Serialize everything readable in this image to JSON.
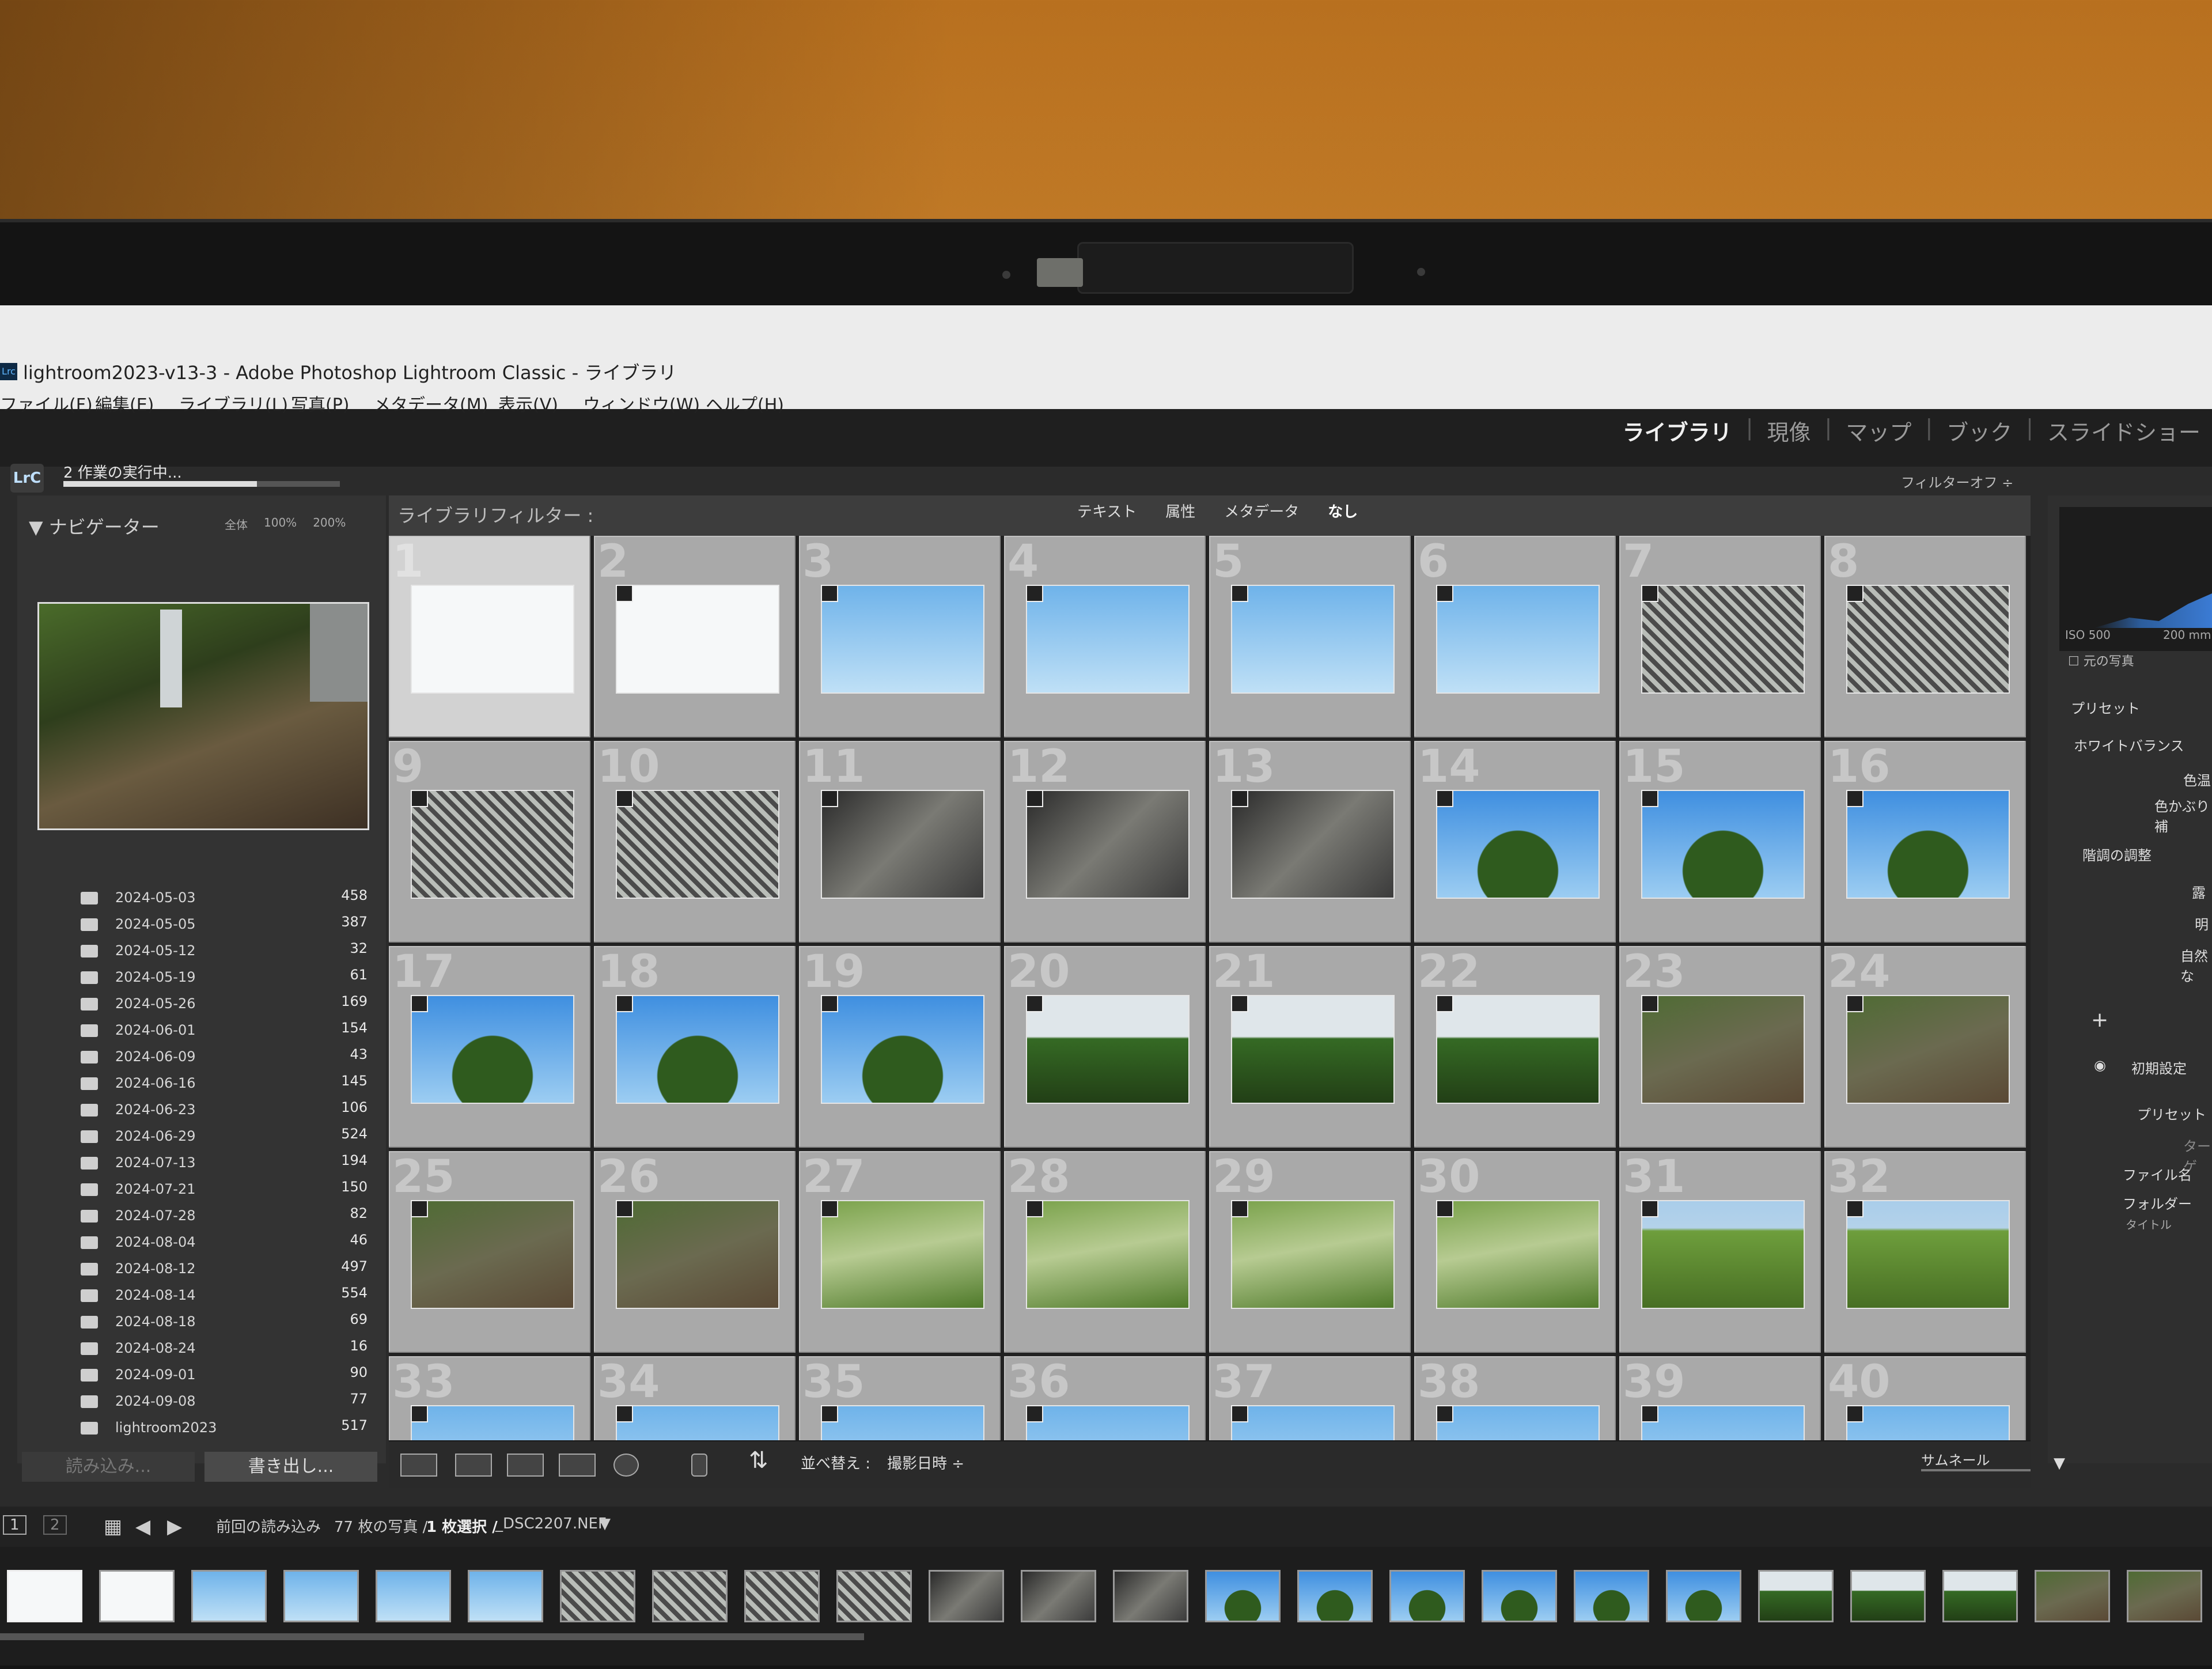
{
  "window": {
    "title": "lightroom2023-v13-3 - Adobe Photoshop Lightroom Classic - ライブラリ",
    "app_icon": "Lrc"
  },
  "menu": [
    "ファイル(F)",
    "編集(E)",
    "ライブラリ(L)",
    "写真(P)",
    "メタデータ(M)",
    "表示(V)",
    "ウィンドウ(W)",
    "ヘルプ(H)"
  ],
  "modules": {
    "items": [
      "ライブラリ",
      "現像",
      "マップ",
      "ブック",
      "スライドショー"
    ],
    "active": "ライブラリ",
    "separator": "|"
  },
  "identity": {
    "badge": "LrC",
    "task_text": "2 作業の実行中...",
    "task_progress": 0.7
  },
  "navigator": {
    "title": "ナビゲーター",
    "zoom_options": [
      "全体",
      "100%",
      "200%"
    ]
  },
  "folders": [
    {
      "name": "2024-05-03",
      "count": "458"
    },
    {
      "name": "2024-05-05",
      "count": "387"
    },
    {
      "name": "2024-05-12",
      "count": "32"
    },
    {
      "name": "2024-05-19",
      "count": "61"
    },
    {
      "name": "2024-05-26",
      "count": "169"
    },
    {
      "name": "2024-06-01",
      "count": "154"
    },
    {
      "name": "2024-06-09",
      "count": "43"
    },
    {
      "name": "2024-06-16",
      "count": "145"
    },
    {
      "name": "2024-06-23",
      "count": "106"
    },
    {
      "name": "2024-06-29",
      "count": "524"
    },
    {
      "name": "2024-07-13",
      "count": "194"
    },
    {
      "name": "2024-07-21",
      "count": "150"
    },
    {
      "name": "2024-07-28",
      "count": "82"
    },
    {
      "name": "2024-08-04",
      "count": "46"
    },
    {
      "name": "2024-08-12",
      "count": "497"
    },
    {
      "name": "2024-08-14",
      "count": "554"
    },
    {
      "name": "2024-08-18",
      "count": "69"
    },
    {
      "name": "2024-08-24",
      "count": "16"
    },
    {
      "name": "2024-09-01",
      "count": "90"
    },
    {
      "name": "2024-09-08",
      "count": "77"
    },
    {
      "name": "lightroom2023",
      "count": "517"
    }
  ],
  "left_buttons": {
    "import": "読み込み...",
    "export": "書き出し..."
  },
  "filter": {
    "label": "ライブラリフィルター :",
    "tabs": [
      "テキスト",
      "属性",
      "メタデータ",
      "なし"
    ],
    "filter_off": "フィルターオフ ÷"
  },
  "grid": {
    "cells": [
      {
        "n": "1",
        "k": "white"
      },
      {
        "n": "2",
        "k": "white"
      },
      {
        "n": "3",
        "k": "sky"
      },
      {
        "n": "4",
        "k": "sky"
      },
      {
        "n": "5",
        "k": "sky"
      },
      {
        "n": "6",
        "k": "sky"
      },
      {
        "n": "7",
        "k": "fence"
      },
      {
        "n": "8",
        "k": "fence"
      },
      {
        "n": "9",
        "k": "fence"
      },
      {
        "n": "10",
        "k": "fence"
      },
      {
        "n": "11",
        "k": "vine"
      },
      {
        "n": "12",
        "k": "vine"
      },
      {
        "n": "13",
        "k": "vine"
      },
      {
        "n": "14",
        "k": "tree"
      },
      {
        "n": "15",
        "k": "tree"
      },
      {
        "n": "16",
        "k": "tree"
      },
      {
        "n": "17",
        "k": "tree"
      },
      {
        "n": "18",
        "k": "tree"
      },
      {
        "n": "19",
        "k": "tree"
      },
      {
        "n": "20",
        "k": "field"
      },
      {
        "n": "21",
        "k": "field"
      },
      {
        "n": "22",
        "k": "field"
      },
      {
        "n": "23",
        "k": "pole"
      },
      {
        "n": "24",
        "k": "pole"
      },
      {
        "n": "25",
        "k": "pole"
      },
      {
        "n": "26",
        "k": "pole"
      },
      {
        "n": "27",
        "k": "grass"
      },
      {
        "n": "28",
        "k": "grass"
      },
      {
        "n": "29",
        "k": "grass"
      },
      {
        "n": "30",
        "k": "grass"
      },
      {
        "n": "31",
        "k": "bush"
      },
      {
        "n": "32",
        "k": "bush"
      },
      {
        "n": "33",
        "k": "sky"
      },
      {
        "n": "34",
        "k": "sky"
      },
      {
        "n": "35",
        "k": "sky"
      },
      {
        "n": "36",
        "k": "sky"
      },
      {
        "n": "37",
        "k": "sky"
      },
      {
        "n": "38",
        "k": "sky"
      },
      {
        "n": "39",
        "k": "sky"
      },
      {
        "n": "40",
        "k": "sky"
      }
    ],
    "selected": "1"
  },
  "right_panel": {
    "histogram_info": "ISO 500",
    "histogram_info2": "200 mm",
    "original_photo": "元の写真",
    "preset": "プリセット",
    "white_balance": "ホワイトバランス",
    "wb_line1": "色温",
    "wb_line2": "色かぶり補",
    "tone": "階調の調整",
    "tone_1": "露",
    "tone_2": "明",
    "tone_3": "自然な",
    "plus": "+",
    "default_settings": "初期設定",
    "preset_btn": "プリセット",
    "target": "ターゲ",
    "file_name": "ファイル名",
    "folder": "フォルダー",
    "title": "タイトル"
  },
  "toolbar": {
    "sort_label": "並べ替え :",
    "sort_value": "撮影日時 ÷",
    "thumb_label": "サムネール"
  },
  "filmstrip": {
    "pages": [
      "1",
      "2"
    ],
    "source": "前回の読み込み",
    "count": "77 枚の写真 /",
    "selected": "1 枚選択 /",
    "filename": "_DSC2207.NEF",
    "thumbs": [
      "white",
      "white",
      "sky",
      "sky",
      "sky",
      "sky",
      "fence",
      "fence",
      "fence",
      "fence",
      "vine",
      "vine",
      "vine",
      "tree",
      "tree",
      "tree",
      "tree",
      "tree",
      "tree",
      "field",
      "field",
      "field",
      "pole",
      "pole"
    ]
  },
  "colors": {
    "accent": "#e9e9ea",
    "panel": "#333333",
    "grid_cell": "#a9a9a9"
  }
}
